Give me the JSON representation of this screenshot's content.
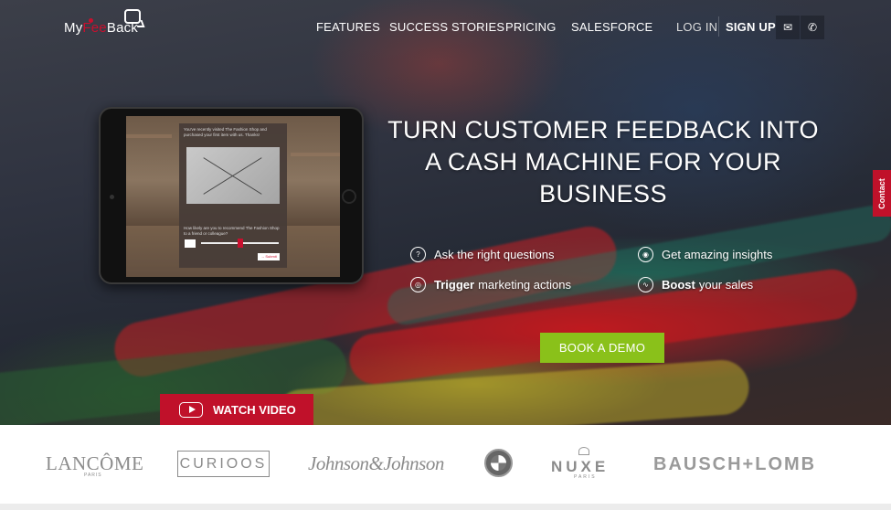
{
  "brand": {
    "logo_part1": "My",
    "logo_part2": "Fee",
    "logo_part3": "Back"
  },
  "nav": {
    "items": [
      "FEATURES",
      "SUCCESS STORIES",
      "PRICING",
      "SALESFORCE"
    ],
    "login": "LOG IN",
    "signup": "SIGN UP",
    "icons": [
      "mail-icon",
      "phone-icon"
    ]
  },
  "tablet": {
    "survey_intro": "You've recently visited The Fashion Shop and purchased your first item with us. Thanks!",
    "survey_question": "How likely are you to recommend The Fashion Shop to a friend or colleague?",
    "survey_submit": "→ Submit"
  },
  "hero": {
    "headline": "TURN CUSTOMER FEEDBACK INTO A CASH MACHINE FOR YOUR BUSINESS",
    "features": [
      {
        "bold": "",
        "text": "Ask the right questions",
        "icon": "question-icon"
      },
      {
        "bold": "",
        "text": "Get amazing insights",
        "icon": "eye-icon"
      },
      {
        "bold": "Trigger",
        "text": "marketing actions",
        "icon": "target-icon"
      },
      {
        "bold": "Boost",
        "text": "your sales",
        "icon": "chart-icon"
      }
    ],
    "demo_button": "BOOK A DEMO",
    "video_button": "WATCH VIDEO"
  },
  "contact_tab": "Contact",
  "clients": {
    "lancome": "LANCÔME",
    "lancome_sub": "PARIS",
    "curioos": "CURIOOS",
    "jnj": "Johnson&Johnson",
    "nuxe": "NUXE",
    "nuxe_sub": "PARIS",
    "bausch": "BAUSCH+LOMB"
  },
  "colors": {
    "brand_red": "#c0112a",
    "demo_green": "#8ac11a"
  }
}
